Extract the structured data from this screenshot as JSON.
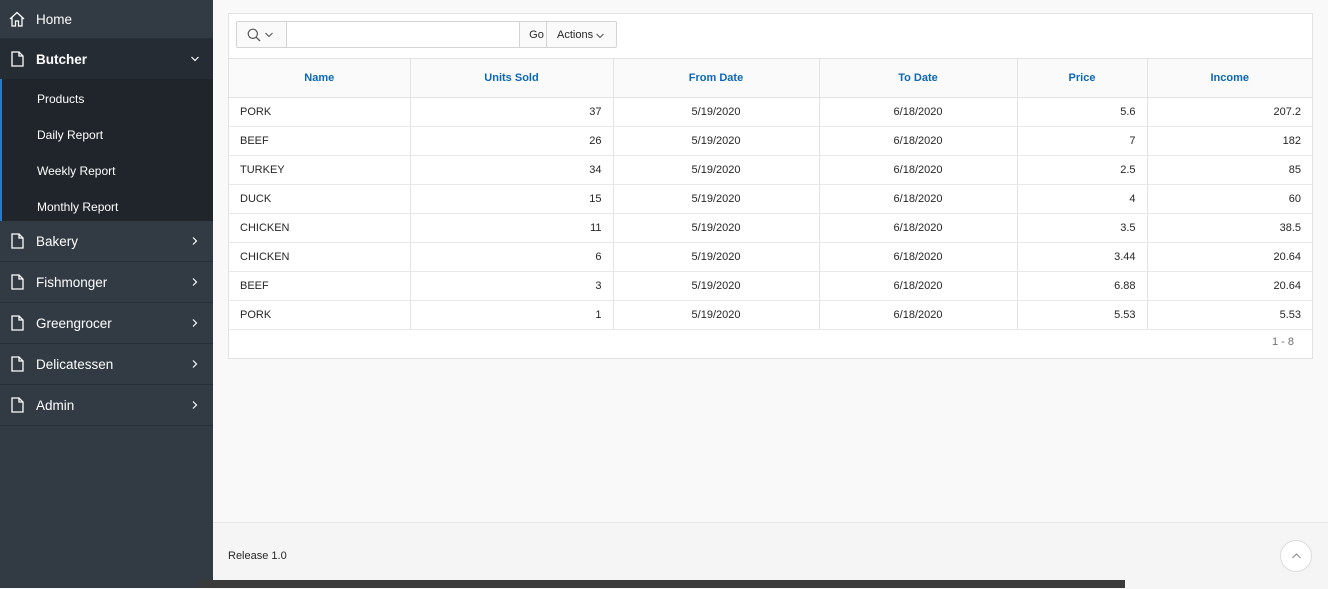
{
  "sidebar": {
    "home": "Home",
    "current": "Butcher",
    "sub_items": [
      "Products",
      "Daily Report",
      "Weekly Report",
      "Monthly Report"
    ],
    "others": [
      "Bakery",
      "Fishmonger",
      "Greengrocer",
      "Delicatessen",
      "Admin"
    ]
  },
  "toolbar": {
    "search_placeholder": "",
    "go_label": "Go",
    "actions_label": "Actions"
  },
  "table": {
    "columns": [
      "Name",
      "Units Sold",
      "From Date",
      "To Date",
      "Price",
      "Income"
    ],
    "rows": [
      [
        "PORK",
        "37",
        "5/19/2020",
        "6/18/2020",
        "5.6",
        "207.2"
      ],
      [
        "BEEF",
        "26",
        "5/19/2020",
        "6/18/2020",
        "7",
        "182"
      ],
      [
        "TURKEY",
        "34",
        "5/19/2020",
        "6/18/2020",
        "2.5",
        "85"
      ],
      [
        "DUCK",
        "15",
        "5/19/2020",
        "6/18/2020",
        "4",
        "60"
      ],
      [
        "CHICKEN",
        "11",
        "5/19/2020",
        "6/18/2020",
        "3.5",
        "38.5"
      ],
      [
        "CHICKEN",
        "6",
        "5/19/2020",
        "6/18/2020",
        "3.44",
        "20.64"
      ],
      [
        "BEEF",
        "3",
        "5/19/2020",
        "6/18/2020",
        "6.88",
        "20.64"
      ],
      [
        "PORK",
        "1",
        "5/19/2020",
        "6/18/2020",
        "5.53",
        "5.53"
      ]
    ],
    "pagination": "1 - 8"
  },
  "footer": {
    "release": "Release 1.0"
  },
  "colors": {
    "sidebar_bg": "#323a43",
    "accent": "#0b67b7"
  }
}
